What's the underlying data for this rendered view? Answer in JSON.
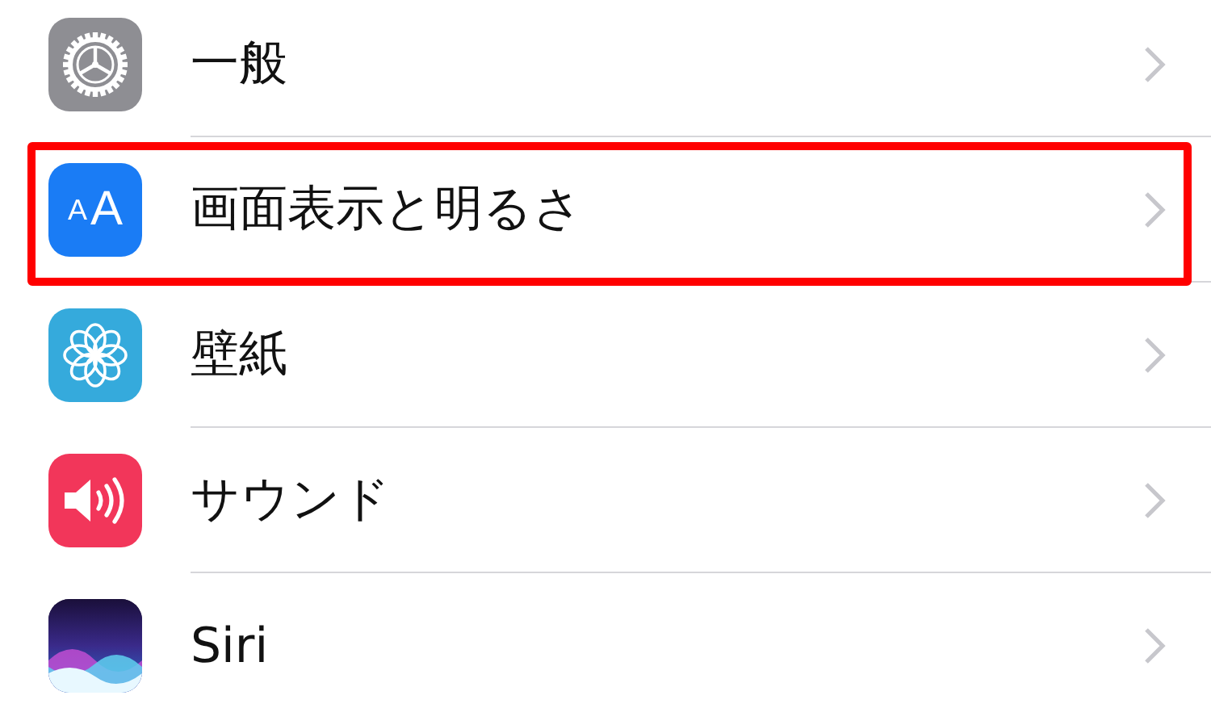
{
  "rows": [
    {
      "kind": "gear",
      "label": "一般",
      "highlighted": false
    },
    {
      "kind": "text-size",
      "icon_text": [
        "A",
        "A"
      ],
      "label": "画面表示と明るさ",
      "highlighted": true
    },
    {
      "kind": "flower",
      "label": "壁紙",
      "highlighted": false
    },
    {
      "kind": "speaker",
      "label": "サウンド",
      "highlighted": false
    },
    {
      "kind": "siri",
      "label": "Siri",
      "highlighted": false
    }
  ]
}
